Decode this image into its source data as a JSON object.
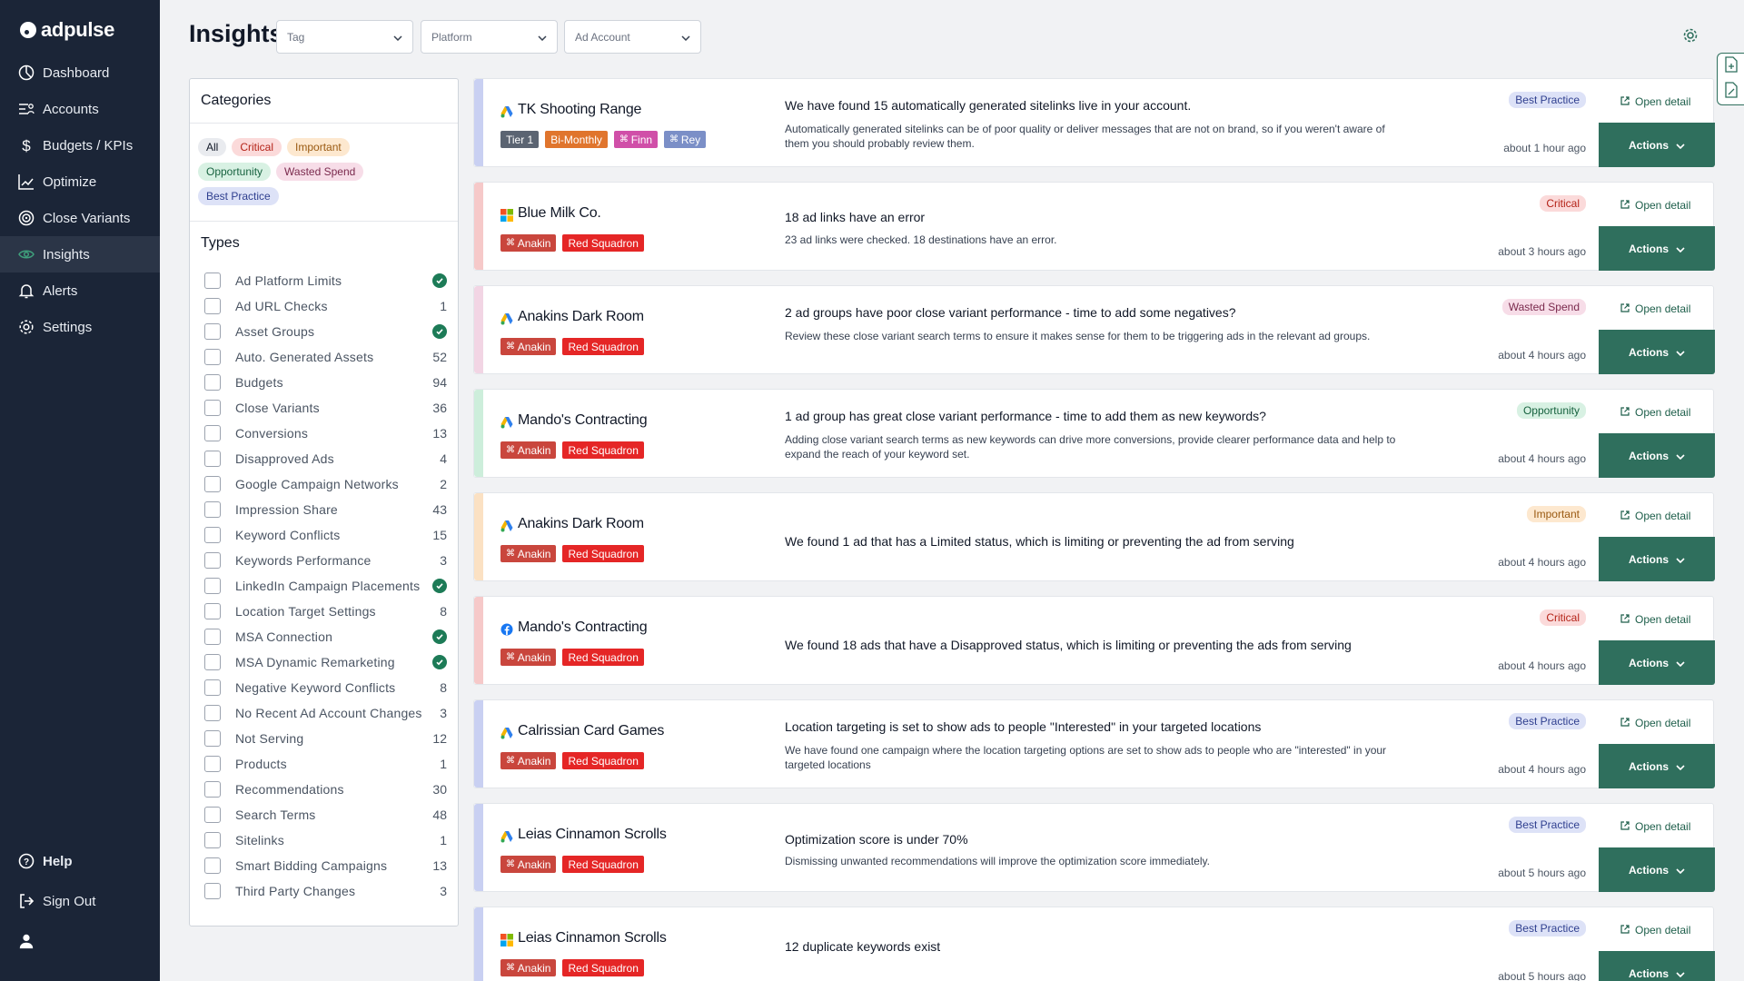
{
  "app": {
    "brand": "adpulse"
  },
  "nav": {
    "items": [
      {
        "label": "Dashboard",
        "icon": "dashboard-icon"
      },
      {
        "label": "Accounts",
        "icon": "accounts-icon"
      },
      {
        "label": "Budgets / KPIs",
        "icon": "dollar-icon"
      },
      {
        "label": "Optimize",
        "icon": "chart-line-icon"
      },
      {
        "label": "Close Variants",
        "icon": "target-icon"
      },
      {
        "label": "Insights",
        "icon": "eye-icon",
        "active": true
      },
      {
        "label": "Alerts",
        "icon": "bell-icon"
      },
      {
        "label": "Settings",
        "icon": "gear-icon"
      }
    ],
    "help": "Help",
    "signout": "Sign Out"
  },
  "header": {
    "title": "Insights",
    "filters": {
      "tag": "Tag",
      "platform": "Platform",
      "ad_account": "Ad Account"
    }
  },
  "panel": {
    "categories_title": "Categories",
    "categories": [
      {
        "label": "All",
        "bg": "#e9ebef",
        "fg": "#111827"
      },
      {
        "label": "Critical",
        "bg": "#fbdada",
        "fg": "#b42318"
      },
      {
        "label": "Important",
        "bg": "#fde8cf",
        "fg": "#9a5a12"
      },
      {
        "label": "Opportunity",
        "bg": "#d8f1e3",
        "fg": "#17623f"
      },
      {
        "label": "Wasted Spend",
        "bg": "#f7dde8",
        "fg": "#7a2a4d"
      },
      {
        "label": "Best Practice",
        "bg": "#dde2f7",
        "fg": "#2f3f8f"
      }
    ],
    "types_title": "Types",
    "types": [
      {
        "label": "Ad Platform Limits",
        "count": "",
        "check": true
      },
      {
        "label": "Ad URL Checks",
        "count": "1"
      },
      {
        "label": "Asset Groups",
        "count": "",
        "check": true
      },
      {
        "label": "Auto. Generated Assets",
        "count": "52"
      },
      {
        "label": "Budgets",
        "count": "94"
      },
      {
        "label": "Close Variants",
        "count": "36"
      },
      {
        "label": "Conversions",
        "count": "13"
      },
      {
        "label": "Disapproved Ads",
        "count": "4"
      },
      {
        "label": "Google Campaign Networks",
        "count": "2"
      },
      {
        "label": "Impression Share",
        "count": "43"
      },
      {
        "label": "Keyword Conflicts",
        "count": "15"
      },
      {
        "label": "Keywords Performance",
        "count": "3"
      },
      {
        "label": "LinkedIn Campaign Placements",
        "count": "",
        "check": true
      },
      {
        "label": "Location Target Settings",
        "count": "8"
      },
      {
        "label": "MSA Connection",
        "count": "",
        "check": true
      },
      {
        "label": "MSA Dynamic Remarketing",
        "count": "",
        "check": true
      },
      {
        "label": "Negative Keyword Conflicts",
        "count": "8"
      },
      {
        "label": "No Recent Ad Account Changes",
        "count": "3"
      },
      {
        "label": "Not Serving",
        "count": "12"
      },
      {
        "label": "Products",
        "count": "1"
      },
      {
        "label": "Recommendations",
        "count": "30"
      },
      {
        "label": "Search Terms",
        "count": "48"
      },
      {
        "label": "Sitelinks",
        "count": "1"
      },
      {
        "label": "Smart Bidding Campaigns",
        "count": "13"
      },
      {
        "label": "Third Party Changes",
        "count": "3"
      }
    ]
  },
  "insights": [
    {
      "account": "TK Shooting Range",
      "platform": "google-ads-icon",
      "stripe": "#c9d0f2",
      "tags": [
        {
          "label": "Tier 1",
          "color": "#5b6472",
          "icon": ""
        },
        {
          "label": "Bi-Monthly",
          "color": "#e0752d",
          "icon": ""
        },
        {
          "label": "Finn",
          "color": "#d04fa8",
          "icon": "⌘"
        },
        {
          "label": "Rey",
          "color": "#7b8fc7",
          "icon": "⌘"
        }
      ],
      "title": "We have found 15 automatically generated sitelinks live in your account.",
      "desc": "Automatically generated sitelinks can be of poor quality or deliver messages that are not on brand, so if you weren't aware of them you should probably review them.",
      "badge": {
        "label": "Best Practice",
        "bg": "#dde2f7",
        "fg": "#2f3f8f"
      },
      "time": "about 1 hour ago"
    },
    {
      "account": "Blue Milk Co.",
      "platform": "microsoft-ads-icon",
      "stripe": "#f6c9c9",
      "tags": [
        {
          "label": "Anakin",
          "color": "#c9463d",
          "icon": "⌘"
        },
        {
          "label": "Red Squadron",
          "color": "#e52626",
          "icon": ""
        }
      ],
      "title": "18 ad links have an error",
      "desc": "23 ad links were checked. 18 destinations have an error.",
      "badge": {
        "label": "Critical",
        "bg": "#fbdada",
        "fg": "#b42318"
      },
      "time": "about 3 hours ago"
    },
    {
      "account": "Anakins Dark Room",
      "platform": "google-ads-icon",
      "stripe": "#f2d5e4",
      "tags": [
        {
          "label": "Anakin",
          "color": "#c9463d",
          "icon": "⌘"
        },
        {
          "label": "Red Squadron",
          "color": "#e52626",
          "icon": ""
        }
      ],
      "title": "2 ad groups have poor close variant performance - time to add some negatives?",
      "desc": "Review these close variant search terms to ensure it makes sense for them to be triggering ads in the relevant ad groups.",
      "badge": {
        "label": "Wasted Spend",
        "bg": "#f7dde8",
        "fg": "#7a2a4d"
      },
      "time": "about 4 hours ago"
    },
    {
      "account": "Mando's Contracting",
      "platform": "google-ads-icon",
      "stripe": "#cdeedb",
      "tags": [
        {
          "label": "Anakin",
          "color": "#c9463d",
          "icon": "⌘"
        },
        {
          "label": "Red Squadron",
          "color": "#e52626",
          "icon": ""
        }
      ],
      "title": "1 ad group has great close variant performance - time to add them as new keywords?",
      "desc": "Adding close variant search terms as new keywords can drive more conversions, provide clearer performance data and help to expand the reach of your keyword set.",
      "badge": {
        "label": "Opportunity",
        "bg": "#d8f1e3",
        "fg": "#17623f"
      },
      "time": "about 4 hours ago"
    },
    {
      "account": "Anakins Dark Room",
      "platform": "google-ads-icon",
      "stripe": "#fbe1c3",
      "tags": [
        {
          "label": "Anakin",
          "color": "#c9463d",
          "icon": "⌘"
        },
        {
          "label": "Red Squadron",
          "color": "#e52626",
          "icon": ""
        }
      ],
      "title": "We found 1 ad that has a Limited status, which is limiting or preventing the ad from serving",
      "desc": "",
      "badge": {
        "label": "Important",
        "bg": "#fde8cf",
        "fg": "#9a5a12"
      },
      "time": "about 4 hours ago"
    },
    {
      "account": "Mando's Contracting",
      "platform": "facebook-icon",
      "stripe": "#f6c9c9",
      "tags": [
        {
          "label": "Anakin",
          "color": "#c9463d",
          "icon": "⌘"
        },
        {
          "label": "Red Squadron",
          "color": "#e52626",
          "icon": ""
        }
      ],
      "title": "We found 18 ads that have a Disapproved status, which is limiting or preventing the ads from serving",
      "desc": "",
      "badge": {
        "label": "Critical",
        "bg": "#fbdada",
        "fg": "#b42318"
      },
      "time": "about 4 hours ago"
    },
    {
      "account": "Calrissian Card Games",
      "platform": "google-ads-icon",
      "stripe": "#c9d0f2",
      "tags": [
        {
          "label": "Anakin",
          "color": "#c9463d",
          "icon": "⌘"
        },
        {
          "label": "Red Squadron",
          "color": "#e52626",
          "icon": ""
        }
      ],
      "title": "Location targeting is set to show ads to people \"Interested\" in your targeted locations",
      "desc": "We have found one campaign where the location targeting options are set to show ads to people who are \"interested\" in your targeted locations",
      "badge": {
        "label": "Best Practice",
        "bg": "#dde2f7",
        "fg": "#2f3f8f"
      },
      "time": "about 4 hours ago"
    },
    {
      "account": "Leias Cinnamon Scrolls",
      "platform": "google-ads-icon",
      "stripe": "#c9d0f2",
      "tags": [
        {
          "label": "Anakin",
          "color": "#c9463d",
          "icon": "⌘"
        },
        {
          "label": "Red Squadron",
          "color": "#e52626",
          "icon": ""
        }
      ],
      "title": "Optimization score is under 70%",
      "desc": "Dismissing unwanted recommendations will improve the optimization score immediately.",
      "badge": {
        "label": "Best Practice",
        "bg": "#dde2f7",
        "fg": "#2f3f8f"
      },
      "time": "about 5 hours ago"
    },
    {
      "account": "Leias Cinnamon Scrolls",
      "platform": "microsoft-ads-icon",
      "stripe": "#c9d0f2",
      "tags": [
        {
          "label": "Anakin",
          "color": "#c9463d",
          "icon": "⌘"
        },
        {
          "label": "Red Squadron",
          "color": "#e52626",
          "icon": ""
        }
      ],
      "title": "12 duplicate keywords exist",
      "desc": "",
      "badge": {
        "label": "Best Practice",
        "bg": "#dde2f7",
        "fg": "#2f3f8f"
      },
      "time": "about 5 hours ago"
    }
  ],
  "labels": {
    "open_detail": "Open detail",
    "actions": "Actions"
  },
  "colors": {
    "sidebar": "#1b2537",
    "accent": "#2f6f5d",
    "success": "#1d7b57"
  }
}
